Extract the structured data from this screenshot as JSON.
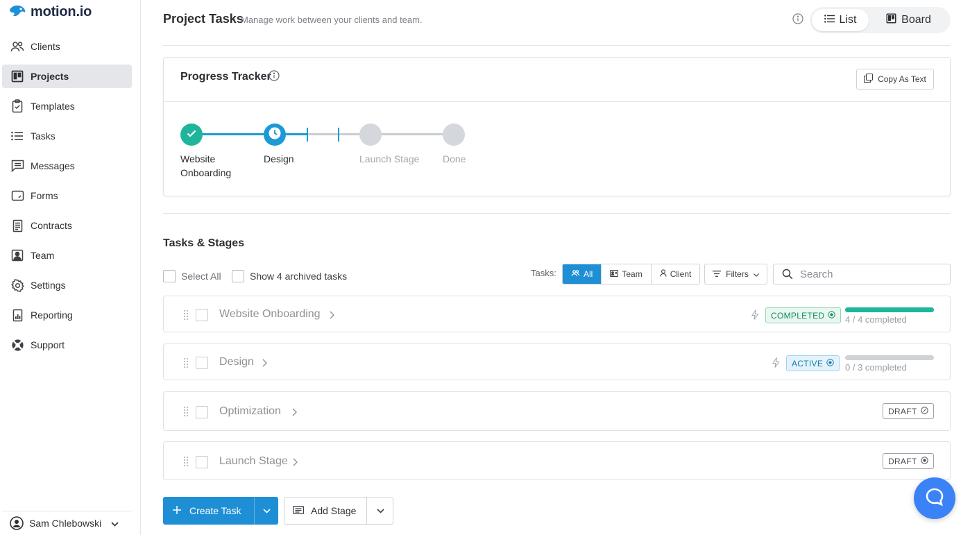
{
  "brand": {
    "name": "motion.io"
  },
  "sidebar": {
    "items": [
      {
        "label": "Clients",
        "icon": "users-icon"
      },
      {
        "label": "Projects",
        "icon": "board-icon",
        "active": true
      },
      {
        "label": "Templates",
        "icon": "clipboard-icon"
      },
      {
        "label": "Tasks",
        "icon": "list-icon"
      },
      {
        "label": "Messages",
        "icon": "message-icon"
      },
      {
        "label": "Forms",
        "icon": "form-icon"
      },
      {
        "label": "Contracts",
        "icon": "document-icon"
      },
      {
        "label": "Team",
        "icon": "team-icon"
      },
      {
        "label": "Settings",
        "icon": "gear-icon"
      },
      {
        "label": "Reporting",
        "icon": "report-icon"
      },
      {
        "label": "Support",
        "icon": "lifebuoy-icon"
      }
    ],
    "user": {
      "name": "Sam Chlebowski"
    }
  },
  "header": {
    "title": "Project Tasks",
    "subtitle": "Manage work between your clients and team.",
    "view_list": "List",
    "view_board": "Board"
  },
  "tracker": {
    "title": "Progress Tracker",
    "copy_label": "Copy As Text",
    "stages": [
      {
        "label_line1": "Website",
        "label_line2": "Onboarding",
        "state": "done"
      },
      {
        "label_line1": "Design",
        "label_line2": "",
        "state": "current"
      },
      {
        "label_line1": "Launch Stage",
        "label_line2": "",
        "state": "pending"
      },
      {
        "label_line1": "Done",
        "label_line2": "",
        "state": "pending"
      }
    ]
  },
  "tasks_section": {
    "title": "Tasks & Stages",
    "select_all": "Select All",
    "show_archived": "Show 4 archived tasks",
    "tasks_label": "Tasks:",
    "filter_all": "All",
    "filter_team": "Team",
    "filter_client": "Client",
    "filters": "Filters",
    "search_placeholder": "Search"
  },
  "stages": [
    {
      "name": "Website Onboarding",
      "status": "COMPLETED",
      "progress": "4 / 4 completed",
      "progress_fraction": 1.0
    },
    {
      "name": "Design",
      "status": "ACTIVE",
      "progress": "0 / 3 completed",
      "progress_fraction": 0.0
    },
    {
      "name": "Optimization",
      "status": "DRAFT"
    },
    {
      "name": "Launch Stage",
      "status": "DRAFT"
    }
  ],
  "actions": {
    "create_task": "Create Task",
    "add_stage": "Add Stage"
  },
  "colors": {
    "accent": "#1e8fd5",
    "success": "#1fb59a",
    "tracker_line": "#1b9ad6"
  }
}
